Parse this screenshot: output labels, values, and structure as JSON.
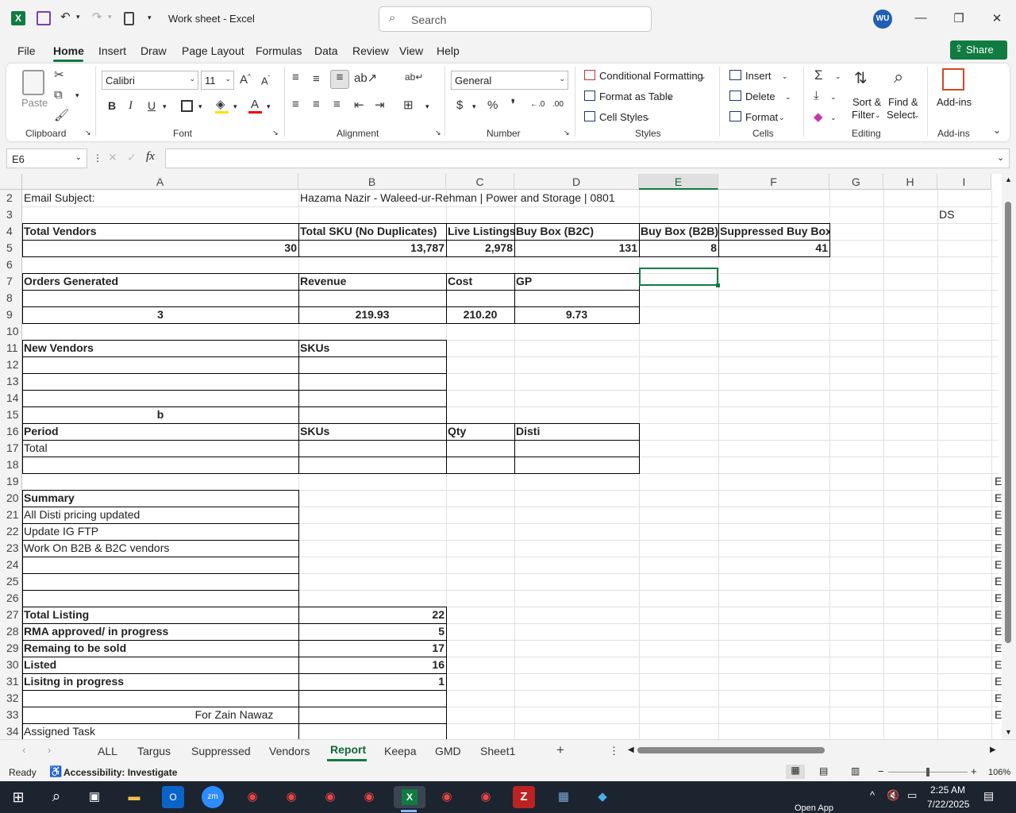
{
  "titlebar": {
    "title": "Work sheet  -  Excel",
    "search_placeholder": "Search",
    "avatar_initials": "WU"
  },
  "menu": {
    "items": [
      "File",
      "Home",
      "Insert",
      "Draw",
      "Page Layout",
      "Formulas",
      "Data",
      "Review",
      "View",
      "Help"
    ],
    "share_label": "Share"
  },
  "ribbon": {
    "clipboard": {
      "paste_label": "Paste",
      "group_label": "Clipboard"
    },
    "font": {
      "font_name": "Calibri",
      "font_size": "11",
      "group_label": "Font"
    },
    "alignment": {
      "group_label": "Alignment"
    },
    "number": {
      "format": "General",
      "group_label": "Number"
    },
    "styles": {
      "conditional_formatting": "Conditional Formatting",
      "format_as_table": "Format as Table",
      "cell_styles": "Cell Styles",
      "group_label": "Styles"
    },
    "cells": {
      "insert": "Insert",
      "delete": "Delete",
      "format": "Format",
      "group_label": "Cells"
    },
    "editing": {
      "sort_filter_1": "Sort &",
      "sort_filter_2": "Filter",
      "find_select_1": "Find &",
      "find_select_2": "Select",
      "group_label": "Editing"
    },
    "addins": {
      "label": "Add-ins",
      "group_label": "Add-ins"
    }
  },
  "formula_bar": {
    "name_box": "E6",
    "formula": ""
  },
  "grid": {
    "columns": [
      "A",
      "B",
      "C",
      "D",
      "E",
      "F",
      "G",
      "H",
      "I"
    ],
    "selected_column": "E",
    "rows": [
      "2",
      "3",
      "4",
      "5",
      "6",
      "7",
      "8",
      "9",
      "10",
      "11",
      "12",
      "13",
      "14",
      "15",
      "16",
      "17",
      "18",
      "19",
      "20",
      "21",
      "22",
      "23",
      "24",
      "25",
      "26",
      "27",
      "28",
      "29",
      "30",
      "31",
      "32",
      "33",
      "34"
    ],
    "cells": {
      "A2": "Email Subject:",
      "B2": "Hazama Nazir - Waleed-ur-Rehman | Power and Storage | 0801",
      "I3": "DS",
      "A4": "Total Vendors",
      "B4": "Total SKU (No Duplicates)",
      "C4": "Live Listings",
      "D4": "Buy Box (B2C)",
      "E4": "Buy Box (B2B)",
      "F4": "Suppressed Buy Box",
      "A5": "30",
      "B5": "13,787",
      "C5": "2,978",
      "D5": "131",
      "E5": "8",
      "F5": "41",
      "A7": "Orders Generated",
      "B7": "Revenue",
      "C7": "Cost",
      "D7": "GP",
      "A9": "3",
      "B9": "219.93",
      "C9": "210.20",
      "D9": "9.73",
      "A11": "New Vendors",
      "B11": "SKUs",
      "A15": "b",
      "A16": "Period",
      "B16": "SKUs",
      "C16": "Qty",
      "D16": "Disti",
      "A17": "Total",
      "A20": "Summary",
      "A21": "All Disti pricing updated",
      "A22": "Update IG FTP",
      "A23": "Work On B2B & B2C vendors",
      "A27": "Total Listing",
      "B27": "22",
      "A28": "RMA approved/ in progress",
      "B28": "5",
      "A29": "Remaing to be sold",
      "B29": "17",
      "A30": "Listed",
      "B30": "16",
      "A31": "Lisitng in progress",
      "B31": "1",
      "A33": "For Zain Nawaz",
      "A34": "Assigned Task",
      "J_overflow": "E"
    }
  },
  "sheet_tabs": [
    "ALL",
    "Targus",
    "Suppressed",
    "Vendors",
    "Report",
    "Keepa",
    "GMD",
    "Sheet1"
  ],
  "active_tab": "Report",
  "status": {
    "ready": "Ready",
    "accessibility": "Accessibility: Investigate",
    "zoom": "106%"
  },
  "taskbar": {
    "time": "2:25 AM",
    "date": "7/22/2025",
    "open_app": "Open App"
  },
  "colors": {
    "excel_green": "#107c41",
    "taskbar": "#1c2430"
  },
  "icons": [
    "excel-logo-icon",
    "save-icon",
    "undo-icon",
    "redo-icon",
    "calculator-icon",
    "search-icon",
    "minimize-icon",
    "maximize-icon",
    "close-icon",
    "share-icon"
  ]
}
